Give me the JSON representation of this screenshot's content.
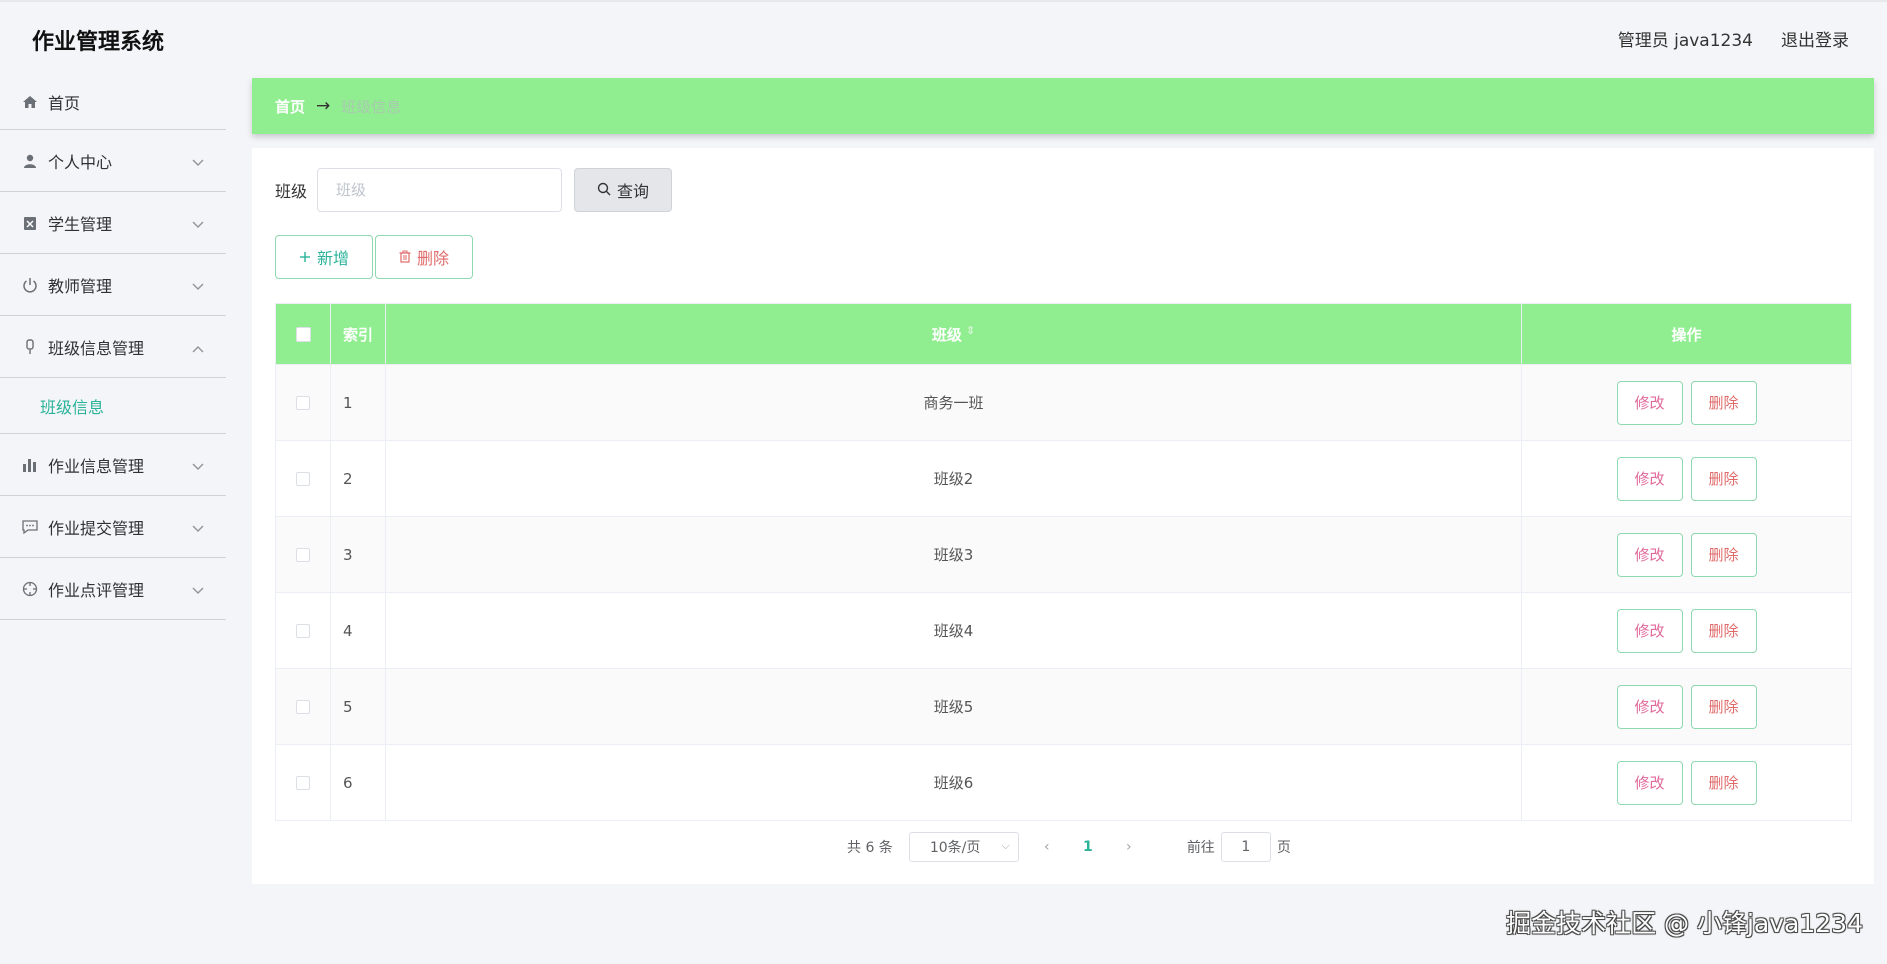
{
  "header": {
    "title": "作业管理系统",
    "user_label": "管理员 java1234",
    "logout_label": "退出登录"
  },
  "sidebar": {
    "items": [
      {
        "label": "首页",
        "icon": "home-icon"
      },
      {
        "label": "个人中心",
        "icon": "user-icon"
      },
      {
        "label": "学生管理",
        "icon": "clipboard-icon"
      },
      {
        "label": "教师管理",
        "icon": "power-icon"
      },
      {
        "label": "班级信息管理",
        "icon": "microphone-icon",
        "expanded": true
      },
      {
        "label": "作业信息管理",
        "icon": "bar-chart-icon"
      },
      {
        "label": "作业提交管理",
        "icon": "chat-icon"
      },
      {
        "label": "作业点评管理",
        "icon": "crosshair-icon"
      }
    ],
    "submenu_active": "班级信息"
  },
  "breadcrumb": {
    "home": "首页",
    "arrow": "→",
    "current": "班级信息"
  },
  "search": {
    "label": "班级",
    "placeholder": "班级",
    "query_label": "查询"
  },
  "actions": {
    "add_label": "新增",
    "delete_label": "删除"
  },
  "table": {
    "columns": [
      "索引",
      "班级",
      "操作"
    ],
    "edit_label": "修改",
    "delete_label": "删除",
    "rows": [
      {
        "index": "1",
        "name": "商务一班"
      },
      {
        "index": "2",
        "name": "班级2"
      },
      {
        "index": "3",
        "name": "班级3"
      },
      {
        "index": "4",
        "name": "班级4"
      },
      {
        "index": "5",
        "name": "班级5"
      },
      {
        "index": "6",
        "name": "班级6"
      }
    ]
  },
  "pagination": {
    "total": "共 6 条",
    "page_size": "10条/页",
    "current_page": "1",
    "goto_prefix": "前往",
    "goto_value": "1",
    "goto_suffix": "页"
  },
  "watermark": "掘金技术社区 @ 小锋java1234",
  "colors": {
    "accent_green": "#90ee90",
    "active_text": "#2bb39a",
    "danger_text": "#e06a6a"
  }
}
